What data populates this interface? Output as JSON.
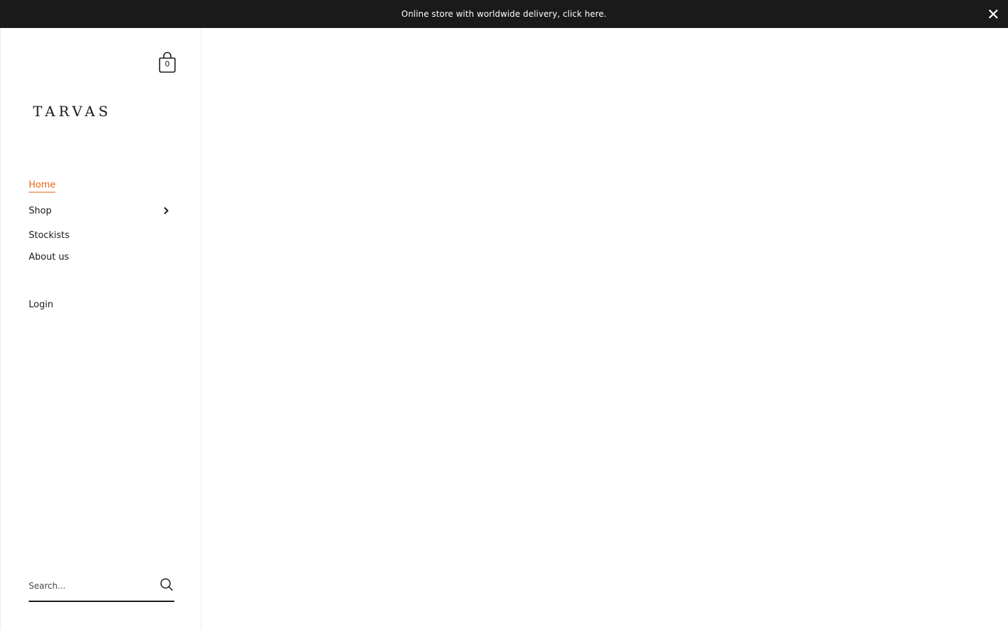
{
  "announcement": {
    "text": "Online store with worldwide delivery, click here.",
    "close_icon": "close-icon"
  },
  "header": {
    "cart_count": "0",
    "cart_icon": "shopping-bag-icon",
    "logo_text": "TARVAS"
  },
  "nav": {
    "items": [
      {
        "label": "Home",
        "active": true
      },
      {
        "label": "Shop",
        "has_submenu": true
      },
      {
        "label": "Stockists"
      },
      {
        "label": "About us"
      }
    ],
    "chevron_icon": "chevron-right-icon"
  },
  "account": {
    "login_label": "Login"
  },
  "search": {
    "placeholder": "Search...",
    "value": "",
    "icon": "search-icon"
  },
  "colors": {
    "accent": "#e0661b",
    "bar": "#1a1a1a",
    "text": "#1a1a1a"
  }
}
